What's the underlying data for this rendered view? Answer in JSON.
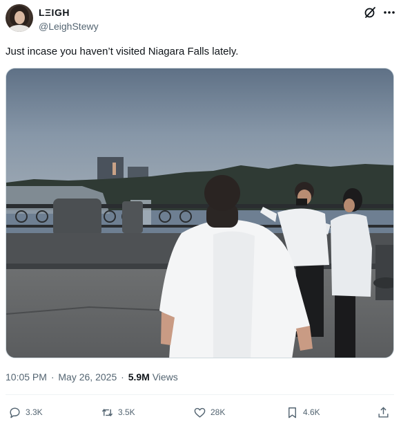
{
  "author": {
    "display_name": "LΞIGH",
    "handle": "@LeighStewy"
  },
  "tweet": {
    "text": "Just incase you haven’t visited Niagara Falls lately."
  },
  "media": {
    "type": "video-gif"
  },
  "meta": {
    "time": "10:05 PM",
    "separator": "·",
    "date": "May 26, 2025",
    "views_count": "5.9M",
    "views_label": "Views"
  },
  "actions": {
    "replies": "3.3K",
    "reposts": "3.5K",
    "likes": "28K",
    "bookmarks": "4.6K"
  },
  "icons": {
    "header": [
      "grok-icon",
      "more-icon"
    ],
    "actions": [
      "reply-icon",
      "repost-icon",
      "like-icon",
      "bookmark-icon",
      "share-icon"
    ]
  },
  "colors": {
    "text_primary": "#0f1419",
    "text_secondary": "#536471",
    "border": "#cfd9de"
  }
}
